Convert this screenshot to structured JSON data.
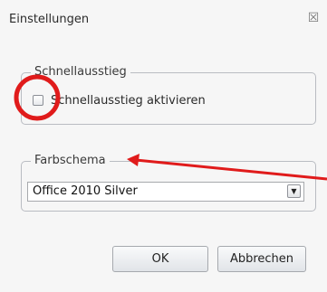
{
  "window": {
    "title": "Einstellungen",
    "close_icon": "close-icon"
  },
  "groups": {
    "quick_exit": {
      "legend": "Schnellausstieg",
      "checkbox_label": "Schnellausstieg aktivieren",
      "checked": false
    },
    "color_scheme": {
      "legend": "Farbschema",
      "selected": "Office 2010 Silver",
      "dropdown_icon": "dropdown-arrow-icon"
    }
  },
  "buttons": {
    "ok": "OK",
    "cancel": "Abbrechen"
  },
  "annotations": {
    "color": "#e01b1b",
    "circle_icon": "highlight-circle",
    "arrow_icon": "arrow-icon"
  }
}
